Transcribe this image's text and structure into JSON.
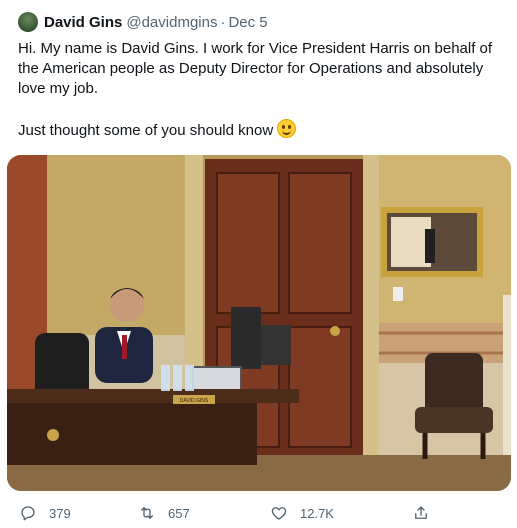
{
  "tweet": {
    "author_name": "David Gins",
    "handle": "@davidmgins",
    "separator": "·",
    "date": "Dec 5",
    "text_p1": "Hi. My name is David Gins. I work for Vice President Harris on behalf of the American people as Deputy Director for Operations and absolutely love my job.",
    "text_p2": "Just thought some of you should know",
    "emoji": "grinning-face-emoji"
  },
  "photo": {
    "nameplate": "DAVID GINS"
  },
  "actions": {
    "replies": "379",
    "retweets": "657",
    "likes": "12.7K",
    "reply_icon": "reply-icon",
    "retweet_icon": "retweet-icon",
    "like_icon": "heart-icon",
    "share_icon": "share-icon"
  },
  "colors": {
    "text_primary": "#0f1419",
    "text_secondary": "#536471"
  }
}
